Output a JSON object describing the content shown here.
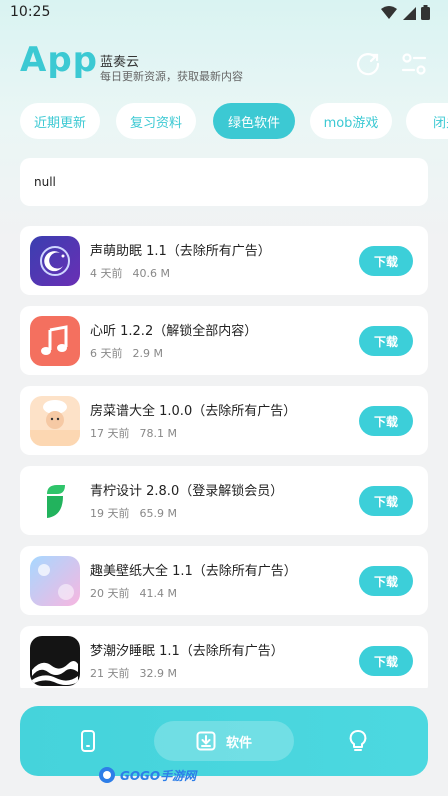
{
  "status_bar": {
    "time": "10:25"
  },
  "header": {
    "logo": "App",
    "name": "蓝奏云",
    "subtitle": "每日更新资源，获取最新内容"
  },
  "tabs": [
    {
      "label": "近期更新",
      "active": false
    },
    {
      "label": "复习资料",
      "active": false
    },
    {
      "label": "绿色软件",
      "active": true
    },
    {
      "label": "mob游戏",
      "active": false
    },
    {
      "label": "闭关",
      "active": false
    }
  ],
  "info_text": "null",
  "items": [
    {
      "title": "声萌助眠 1.1（去除所有广告）",
      "age": "4 天前",
      "size": "40.6 M",
      "button": "下载",
      "icon": "moon-sleep-icon"
    },
    {
      "title": "心听 1.2.2（解锁全部内容）",
      "age": "6 天前",
      "size": "2.9 M",
      "button": "下载",
      "icon": "music-note-icon"
    },
    {
      "title": "房菜谱大全 1.0.0（去除所有广告）",
      "age": "17 天前",
      "size": "78.1 M",
      "button": "下载",
      "icon": "chef-icon",
      "icon_caption": "菜谱大全"
    },
    {
      "title": "青柠设计 2.8.0（登录解锁会员）",
      "age": "19 天前",
      "size": "65.9 M",
      "button": "下载",
      "icon": "green-shape-icon"
    },
    {
      "title": "趣美壁纸大全 1.1（去除所有广告）",
      "age": "20 天前",
      "size": "41.4 M",
      "button": "下载",
      "icon": "wallpaper-icon",
      "icon_caption": "壁纸大全"
    },
    {
      "title": "梦潮汐睡眠 1.1（去除所有广告）",
      "age": "21 天前",
      "size": "32.9 M",
      "button": "下载",
      "icon": "tide-wave-icon",
      "icon_caption": "梦潮汐"
    }
  ],
  "bottom_nav": {
    "active_label": "软件"
  },
  "watermark": "GOGO手游网",
  "colors": {
    "accent": "#3cc9d3",
    "button": "#3ccfd9",
    "background": "#f1f2f3"
  }
}
